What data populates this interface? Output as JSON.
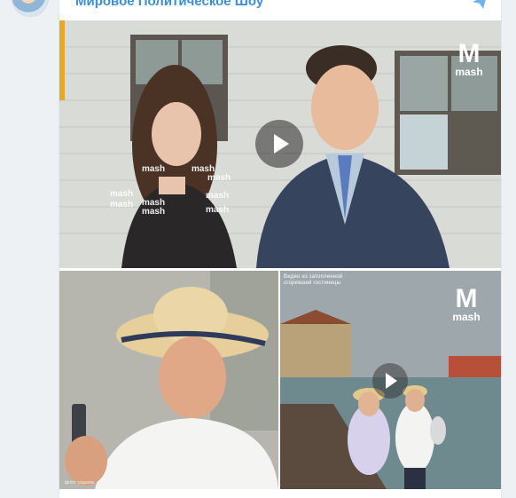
{
  "channel": {
    "name": "Мировое Политическое Шоу"
  },
  "icons": {
    "avatar": "channel-avatar",
    "share": "share-icon",
    "play": "play-icon"
  },
  "media": {
    "main_video": {
      "logo_mark": "M",
      "logo_text": "mash",
      "watermark_text": "mash"
    },
    "photo": {
      "credit": "фото: соцсети"
    },
    "video_two": {
      "logo_mark": "M",
      "logo_text": "mash",
      "overlay_caption": "Видео из затопленной сгоревшей гостиницы"
    }
  },
  "colors": {
    "accent": "#3a8fd6",
    "background": "#eef1f4"
  }
}
